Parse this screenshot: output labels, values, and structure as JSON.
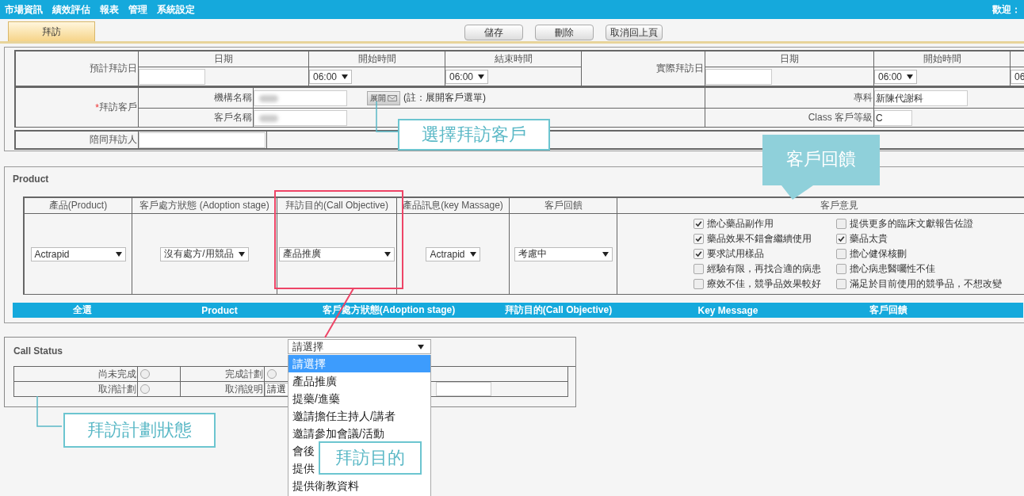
{
  "menu": [
    "市場資訊",
    "績效評估",
    "報表",
    "管理",
    "系統設定"
  ],
  "welcome": "歡迎：",
  "tabs": [
    {
      "label": "拜訪",
      "selected": true
    }
  ],
  "buttons": [
    "儲存",
    "刪除",
    "取消回上頁"
  ],
  "visit_dates": {
    "planned_label": "預計拜訪日",
    "actual_label": "實際拜訪日",
    "date_header": "日期",
    "start_header": "開始時間",
    "end_header": "結束時間",
    "actual_date_header": "日期",
    "actual_start_header": "開始時間",
    "planned_start": "06:00",
    "planned_end": "06:00",
    "actual_start": "06:00",
    "actual_end": "06"
  },
  "customer": {
    "required_mark": "*",
    "label": "拜訪客戶",
    "org_label": "機構名稱",
    "name_label": "客戶名稱",
    "expand_button": "展開",
    "note": "(註：展開客戶選單)",
    "specialty_label": "專科",
    "specialty": "新陳代謝科",
    "class_label": "Class 客戶等級",
    "class_value": "C",
    "companion_label": "陪同拜訪人"
  },
  "product": {
    "title": "Product",
    "columns": [
      "產品(Product)",
      "客戶處方狀態 (Adoption stage)",
      "拜訪目的(Call Objective)",
      "產品訊息(key Massage)",
      "客戶回饋",
      "客戶意見"
    ],
    "row": {
      "product": "Actrapid",
      "adoption": "沒有處方/用競品",
      "objective": "產品推廣",
      "key_message": "Actrapid",
      "feedback": "考慮中"
    },
    "opinions": [
      {
        "label": "擔心藥品副作用",
        "checked": true
      },
      {
        "label": "提供更多的臨床文獻報告佐證",
        "checked": false
      },
      {
        "label": "藥品效果不錯會繼續使用",
        "checked": true
      },
      {
        "label": "藥品太貴",
        "checked": true
      },
      {
        "label": "要求試用樣品",
        "checked": true
      },
      {
        "label": "擔心健保核刪",
        "checked": false
      },
      {
        "label": "經驗有限，再找合適的病患",
        "checked": false
      },
      {
        "label": "擔心病患醫囑性不佳",
        "checked": false
      },
      {
        "label": "療效不佳，競爭品效果較好",
        "checked": false
      },
      {
        "label": "滿足於目前使用的競爭品，不想改變",
        "checked": false
      }
    ],
    "summary_bar": [
      "全選",
      "Product",
      "客戶處方狀態(Adoption stage)",
      "拜訪目的(Call Objective)",
      "Key Message",
      "客戶回饋"
    ]
  },
  "call_status": {
    "title": "Call Status",
    "not_done_label": "尚未完成",
    "not_done": false,
    "done_label": "完成計劃",
    "done": false,
    "cancel_label": "取消計劃",
    "cancel": false,
    "reason_label": "取消說明",
    "reason_value": "請選"
  },
  "objective_dropdown": {
    "value": "請選擇",
    "options": [
      {
        "label": "請選擇",
        "selected": true
      },
      {
        "label": "產品推廣",
        "selected": false
      },
      {
        "label": "提藥/進藥",
        "selected": false
      },
      {
        "label": "邀請擔任主持人/講者",
        "selected": false
      },
      {
        "label": "邀請參加會議/活動",
        "selected": false
      },
      {
        "label": "會後",
        "selected": false
      },
      {
        "label": "提供",
        "selected": false
      },
      {
        "label": "提供衛教資料",
        "selected": false
      }
    ]
  },
  "callouts": [
    {
      "kind": "customer",
      "text": "選擇拜訪客戶"
    },
    {
      "kind": "feedback",
      "text": "客戶回饋"
    },
    {
      "kind": "status",
      "text": "拜訪計劃狀態"
    },
    {
      "kind": "objective",
      "text": "拜訪目的"
    }
  ]
}
